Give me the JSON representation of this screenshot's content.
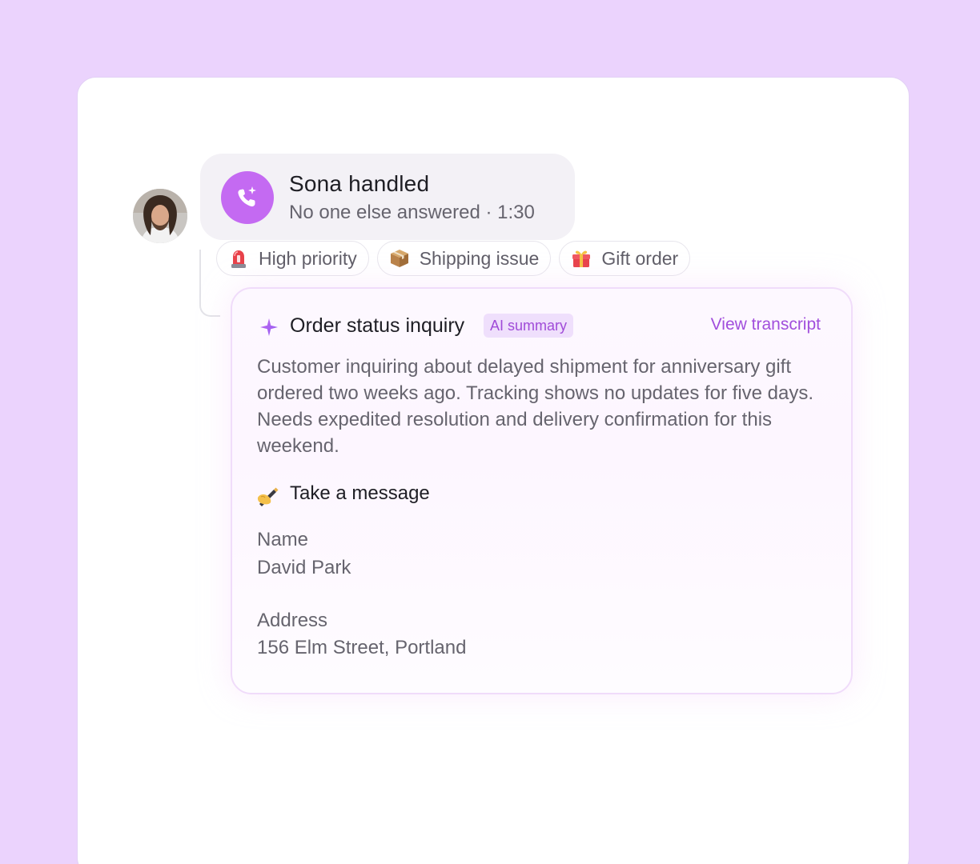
{
  "call": {
    "title": "Sona handled",
    "subtitle": "No one else answered · 1:30",
    "icon": "phone-sparkle-icon",
    "icon_color": "#c46af2"
  },
  "tags": [
    {
      "label": "High priority",
      "icon": "siren-icon"
    },
    {
      "label": "Shipping issue",
      "icon": "package-icon"
    },
    {
      "label": "Gift order",
      "icon": "gift-icon"
    }
  ],
  "summary": {
    "title": "Order status inquiry",
    "badge": "AI summary",
    "link": "View transcript",
    "text": "Customer inquiring about delayed shipment for anniversary gift ordered two weeks ago. Tracking shows no updates for five days. Needs expedited resolution and delivery confirmation for this weekend.",
    "accent_color": "#a14fdc"
  },
  "message": {
    "title": "Take a message",
    "icon": "writing-hand-icon",
    "fields": [
      {
        "label": "Name",
        "value": "David Park"
      },
      {
        "label": "Address",
        "value": "156 Elm Street, Portland"
      }
    ]
  },
  "colors": {
    "background": "#ebd3fd",
    "panel": "#ffffff",
    "text_primary": "#1e1e24",
    "text_secondary": "#66646e"
  }
}
